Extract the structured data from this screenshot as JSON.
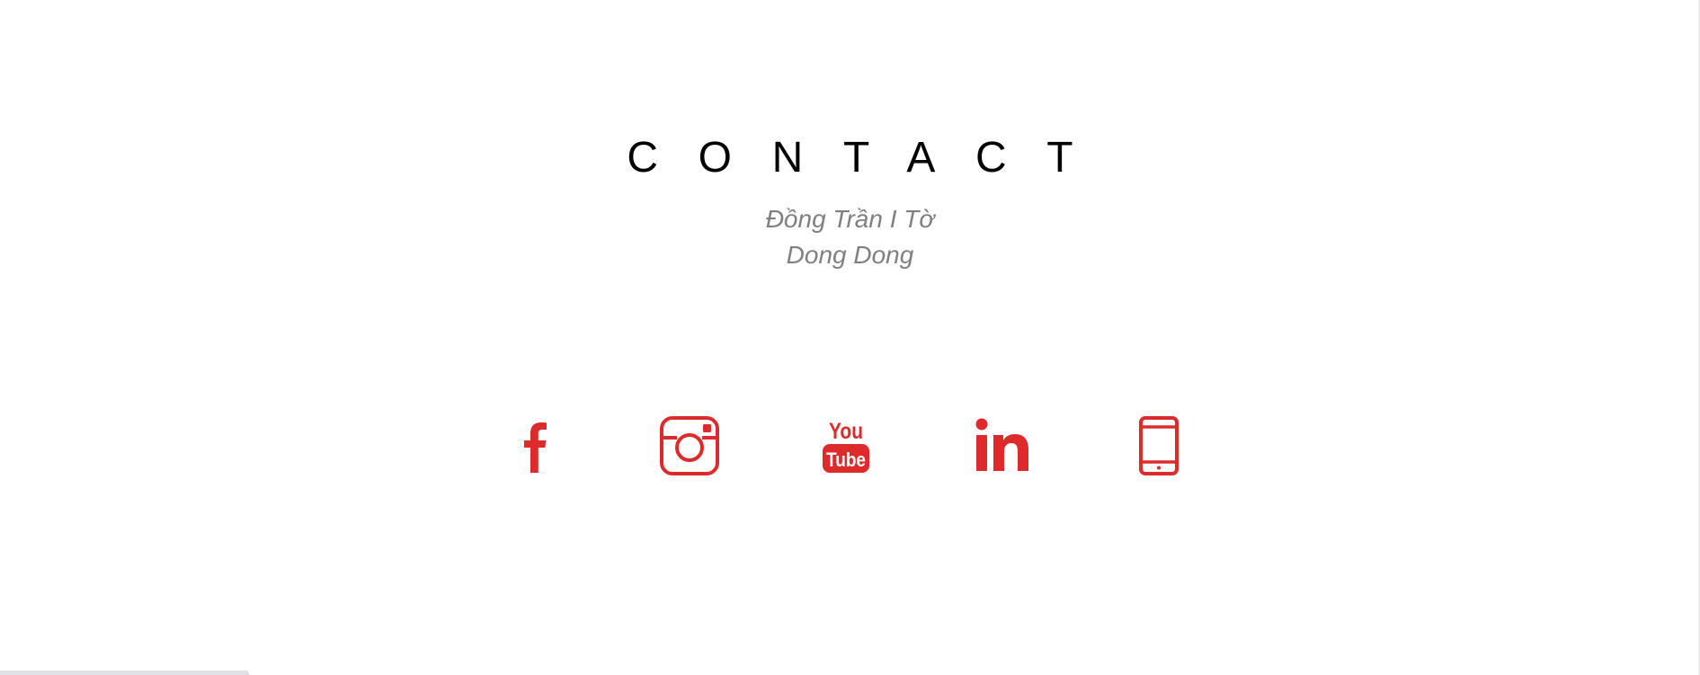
{
  "contact": {
    "title": "CONTACT",
    "subtitle_line1": "Đồng Trần I Tờ",
    "subtitle_line2": "Dong Dong"
  },
  "social": {
    "color": "#dd2b2b",
    "icons": [
      {
        "name": "facebook-icon"
      },
      {
        "name": "instagram-icon"
      },
      {
        "name": "youtube-icon",
        "text_top": "You",
        "text_bottom": "Tube"
      },
      {
        "name": "linkedin-icon"
      },
      {
        "name": "phone-icon"
      }
    ]
  }
}
